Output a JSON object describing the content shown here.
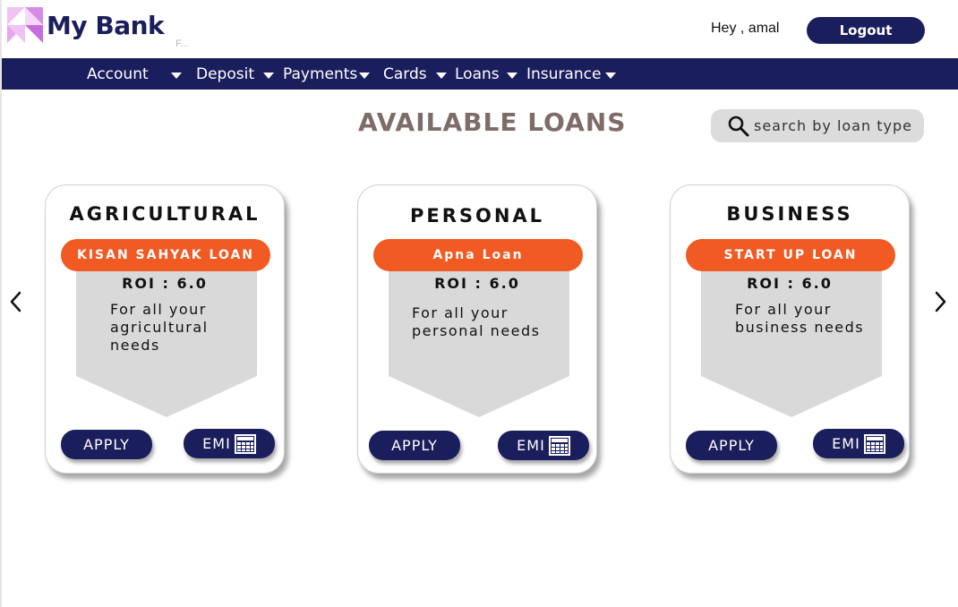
{
  "header": {
    "brand": "My Bank",
    "brand_sub": "F...",
    "greeting": "Hey , amal",
    "logout_label": "Logout"
  },
  "nav": {
    "items": [
      {
        "label": "Account"
      },
      {
        "label": "Deposit"
      },
      {
        "label": "Payments"
      },
      {
        "label": "Cards"
      },
      {
        "label": "Loans"
      },
      {
        "label": "Insurance"
      }
    ]
  },
  "main": {
    "title": "AVAILABLE LOANS",
    "search_placeholder": "search by loan type"
  },
  "cards": [
    {
      "category": "AGRICULTURAL",
      "loan_name": "KISAN SAHYAK LOAN",
      "roi": "ROI : 6.0",
      "description": "For all your agricultural needs",
      "apply_label": "APPLY",
      "emi_label": "EMI"
    },
    {
      "category": "PERSONAL",
      "loan_name": "Apna  Loan",
      "roi": "ROI : 6.0",
      "description": "For all your personal needs",
      "apply_label": "APPLY",
      "emi_label": "EMI"
    },
    {
      "category": "BUSINESS",
      "loan_name": "START UP LOAN",
      "roi": "ROI : 6.0",
      "description": "For all your business needs",
      "apply_label": "APPLY",
      "emi_label": "EMI"
    }
  ],
  "icons": {
    "logo": "triangle-logo-icon",
    "search": "search-icon",
    "prev": "chevron-left-icon",
    "next": "chevron-right-icon",
    "calculator": "calculator-icon",
    "caret": "caret-down-icon"
  },
  "colors": {
    "navy": "#1b1e5c",
    "orange": "#f15a22",
    "title": "#7d6c68",
    "shield": "#d9d9d9",
    "logo_pink": "#e9a6f0",
    "logo_purple": "#c86bdc"
  }
}
